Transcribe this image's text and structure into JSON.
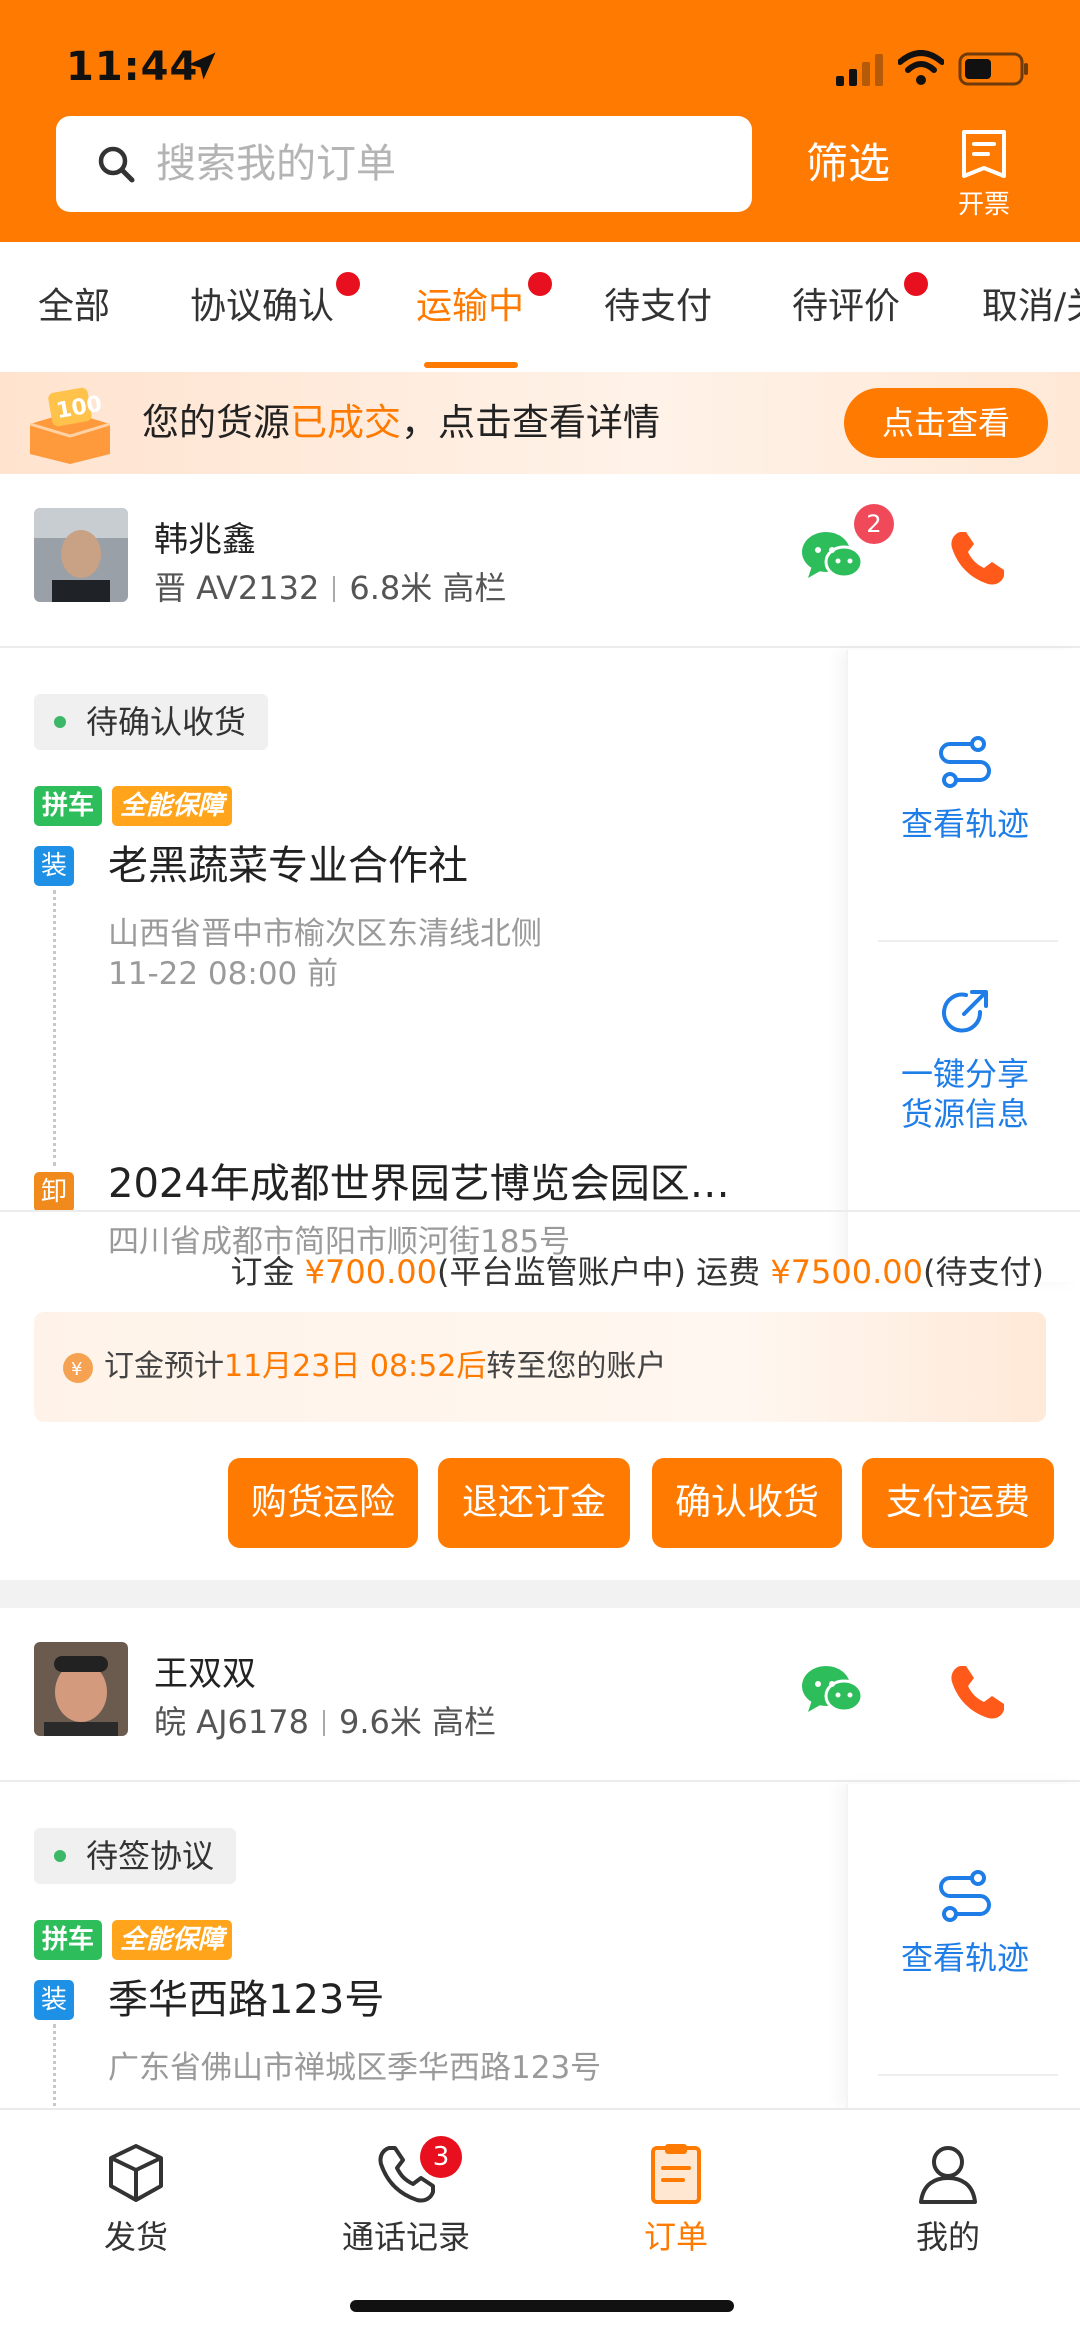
{
  "status_bar": {
    "time": "11:44"
  },
  "header": {
    "search_placeholder": "搜索我的订单",
    "filter_label": "筛选",
    "invoice_label": "开票"
  },
  "tabs": [
    {
      "label": "全部",
      "dot": false
    },
    {
      "label": "协议确认",
      "dot": true
    },
    {
      "label": "运输中",
      "dot": true,
      "active": true
    },
    {
      "label": "待支付",
      "dot": false
    },
    {
      "label": "待评价",
      "dot": true
    },
    {
      "label": "取消/关",
      "dot": false
    }
  ],
  "banner": {
    "text_before": "您的货源",
    "text_highlight": "已成交",
    "text_after": "，点击查看详情",
    "button": "点击查看"
  },
  "orders": [
    {
      "driver_name": "韩兆鑫",
      "plate": "晋 AV2132",
      "vehicle": "6.8米 高栏",
      "chat_badge": "2",
      "status": "待确认收货",
      "tags": [
        "拼车",
        "全能保障"
      ],
      "load_marker": "装",
      "load_title": "老黑蔬菜专业合作社",
      "load_addr": "山西省晋中市榆次区东清线北侧",
      "load_time": "11-22 08:00 前",
      "unload_marker": "卸",
      "unload_title": "2024年成都世界园艺博览会园区…",
      "unload_addr": "四川省成都市简阳市顺河街185号",
      "side_track": "查看轨迹",
      "side_share_1": "一键分享",
      "side_share_2": "货源信息",
      "deposit_label": "订金",
      "deposit_amount": "¥700.00",
      "deposit_note": "(平台监管账户中)",
      "freight_label": "运费",
      "freight_amount": "¥7500.00",
      "freight_note": "(待支付)",
      "notice_prefix": "订金预计",
      "notice_time": "11月23日 08:52后",
      "notice_suffix": "转至您的账户",
      "buttons": [
        "购货运险",
        "退还订金",
        "确认收货",
        "支付运费"
      ]
    },
    {
      "driver_name": "王双双",
      "plate": "皖 AJ6178",
      "vehicle": "9.6米 高栏",
      "status": "待签协议",
      "tags": [
        "拼车",
        "全能保障"
      ],
      "load_marker": "装",
      "load_title": "季华西路123号",
      "load_addr": "广东省佛山市禅城区季华西路123号",
      "side_track": "查看轨迹"
    }
  ],
  "bottom_nav": {
    "items": [
      {
        "label": "发货",
        "icon": "box-icon"
      },
      {
        "label": "通话记录",
        "icon": "phone-log-icon",
        "badge": "3"
      },
      {
        "label": "订单",
        "icon": "clipboard-icon",
        "active": true
      },
      {
        "label": "我的",
        "icon": "person-icon"
      }
    ]
  },
  "colors": {
    "brand": "#ff7a00",
    "link_blue": "#1e7de6",
    "badge_red": "#e8101e"
  }
}
